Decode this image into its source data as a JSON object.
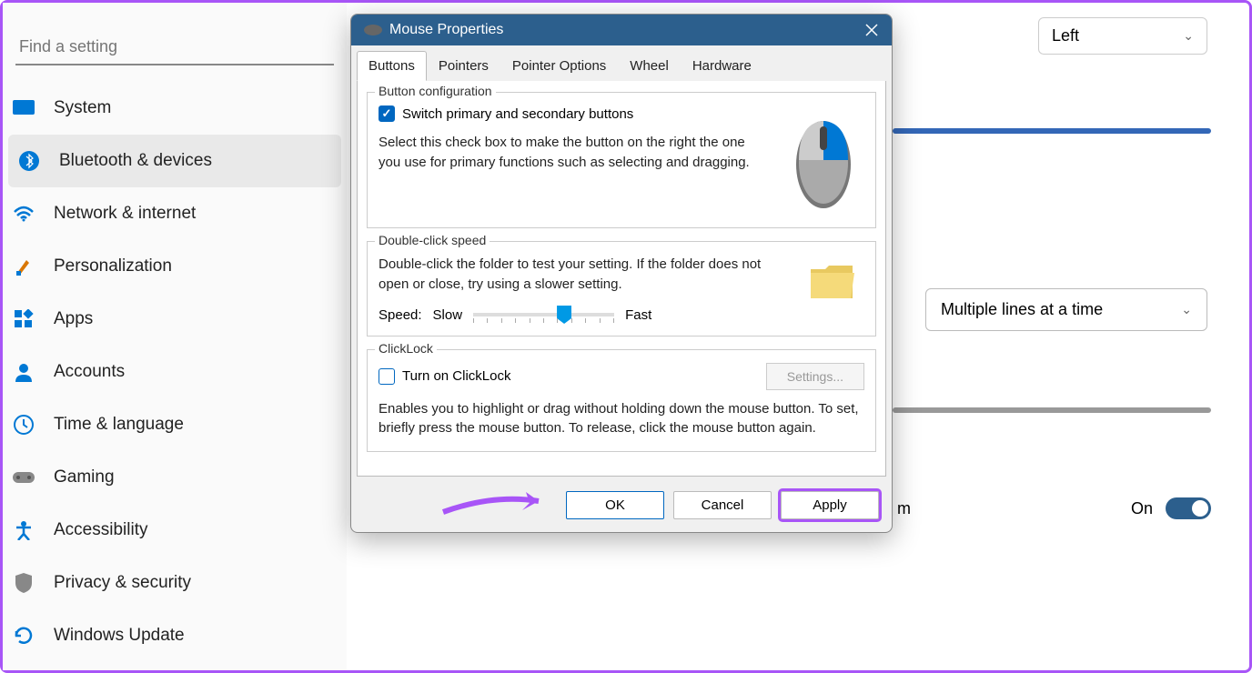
{
  "search": {
    "placeholder": "Find a setting"
  },
  "sidebar": {
    "items": [
      {
        "label": "System",
        "icon": "system"
      },
      {
        "label": "Bluetooth & devices",
        "icon": "bluetooth"
      },
      {
        "label": "Network & internet",
        "icon": "wifi"
      },
      {
        "label": "Personalization",
        "icon": "brush"
      },
      {
        "label": "Apps",
        "icon": "apps"
      },
      {
        "label": "Accounts",
        "icon": "person"
      },
      {
        "label": "Time & language",
        "icon": "clock"
      },
      {
        "label": "Gaming",
        "icon": "gamepad"
      },
      {
        "label": "Accessibility",
        "icon": "accessibility"
      },
      {
        "label": "Privacy & security",
        "icon": "shield"
      },
      {
        "label": "Windows Update",
        "icon": "update"
      }
    ],
    "active_index": 1
  },
  "background_settings": {
    "primary_dropdown_value": "Left",
    "scroll_dropdown_value": "Multiple lines at a time",
    "toggle_label": "On",
    "partial_label_suffix": "m"
  },
  "dialog": {
    "title": "Mouse Properties",
    "tabs": [
      "Buttons",
      "Pointers",
      "Pointer Options",
      "Wheel",
      "Hardware"
    ],
    "active_tab": 0,
    "button_config": {
      "title": "Button configuration",
      "checkbox_label": "Switch primary and secondary buttons",
      "checkbox_checked": true,
      "description": "Select this check box to make the button on the right the one you use for primary functions such as selecting and dragging."
    },
    "double_click": {
      "title": "Double-click speed",
      "description": "Double-click the folder to test your setting. If the folder does not open or close, try using a slower setting.",
      "speed_label": "Speed:",
      "slow_label": "Slow",
      "fast_label": "Fast"
    },
    "clicklock": {
      "title": "ClickLock",
      "checkbox_label": "Turn on ClickLock",
      "checkbox_checked": false,
      "settings_button": "Settings...",
      "description": "Enables you to highlight or drag without holding down the mouse button. To set, briefly press the mouse button. To release, click the mouse button again."
    },
    "buttons": {
      "ok": "OK",
      "cancel": "Cancel",
      "apply": "Apply"
    }
  }
}
